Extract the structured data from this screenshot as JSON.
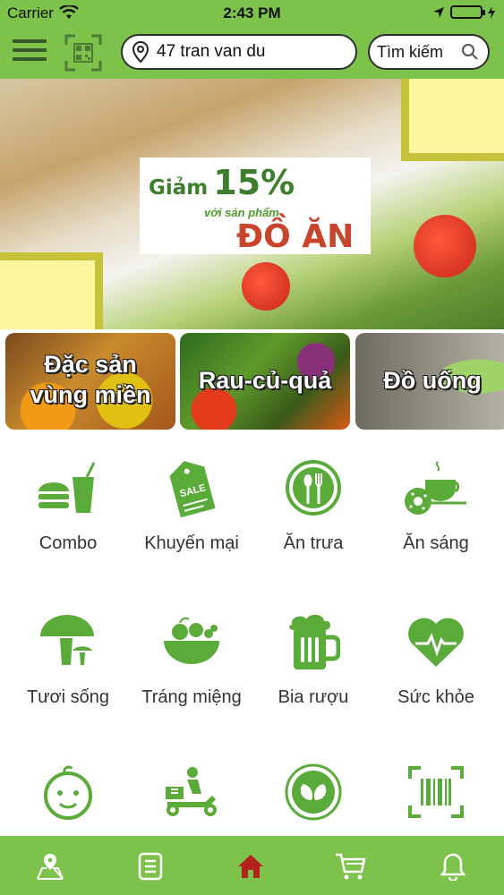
{
  "status": {
    "carrier": "Carrier",
    "time": "2:43 PM"
  },
  "header": {
    "address": "47 tran van du",
    "search_label": "Tìm kiếm"
  },
  "banner": {
    "promo_word": "Giảm",
    "promo_percent": "15%",
    "promo_sub": "với sản phẩm",
    "promo_category": "ĐỒ ĂN"
  },
  "categories": [
    {
      "line1": "Đặc sản",
      "line2": "vùng miền"
    },
    {
      "line1": "Rau-củ-quả"
    },
    {
      "line1": "Đồ uống"
    }
  ],
  "grid": [
    {
      "label": "Combo",
      "icon": "combo-icon"
    },
    {
      "label": "Khuyến mại",
      "icon": "sale-tag-icon"
    },
    {
      "label": "Ăn trưa",
      "icon": "spoon-fork-icon"
    },
    {
      "label": "Ăn sáng",
      "icon": "coffee-donut-icon"
    },
    {
      "label": "Tươi sống",
      "icon": "mushroom-icon"
    },
    {
      "label": "Tráng miệng",
      "icon": "fruit-bowl-icon"
    },
    {
      "label": "Bia rượu",
      "icon": "beer-icon"
    },
    {
      "label": "Sức khỏe",
      "icon": "heart-pulse-icon"
    },
    {
      "label": "",
      "icon": "baby-face-icon"
    },
    {
      "label": "",
      "icon": "delivery-scooter-icon"
    },
    {
      "label": "",
      "icon": "leaf-circle-icon"
    },
    {
      "label": "",
      "icon": "barcode-scan-icon"
    }
  ],
  "tabbar": [
    "map-icon",
    "orders-icon",
    "home-icon",
    "cart-icon",
    "bell-icon"
  ],
  "colors": {
    "brand_green": "#7dc24b",
    "icon_green": "#5aab3a",
    "active_tab": "#b3221b"
  }
}
